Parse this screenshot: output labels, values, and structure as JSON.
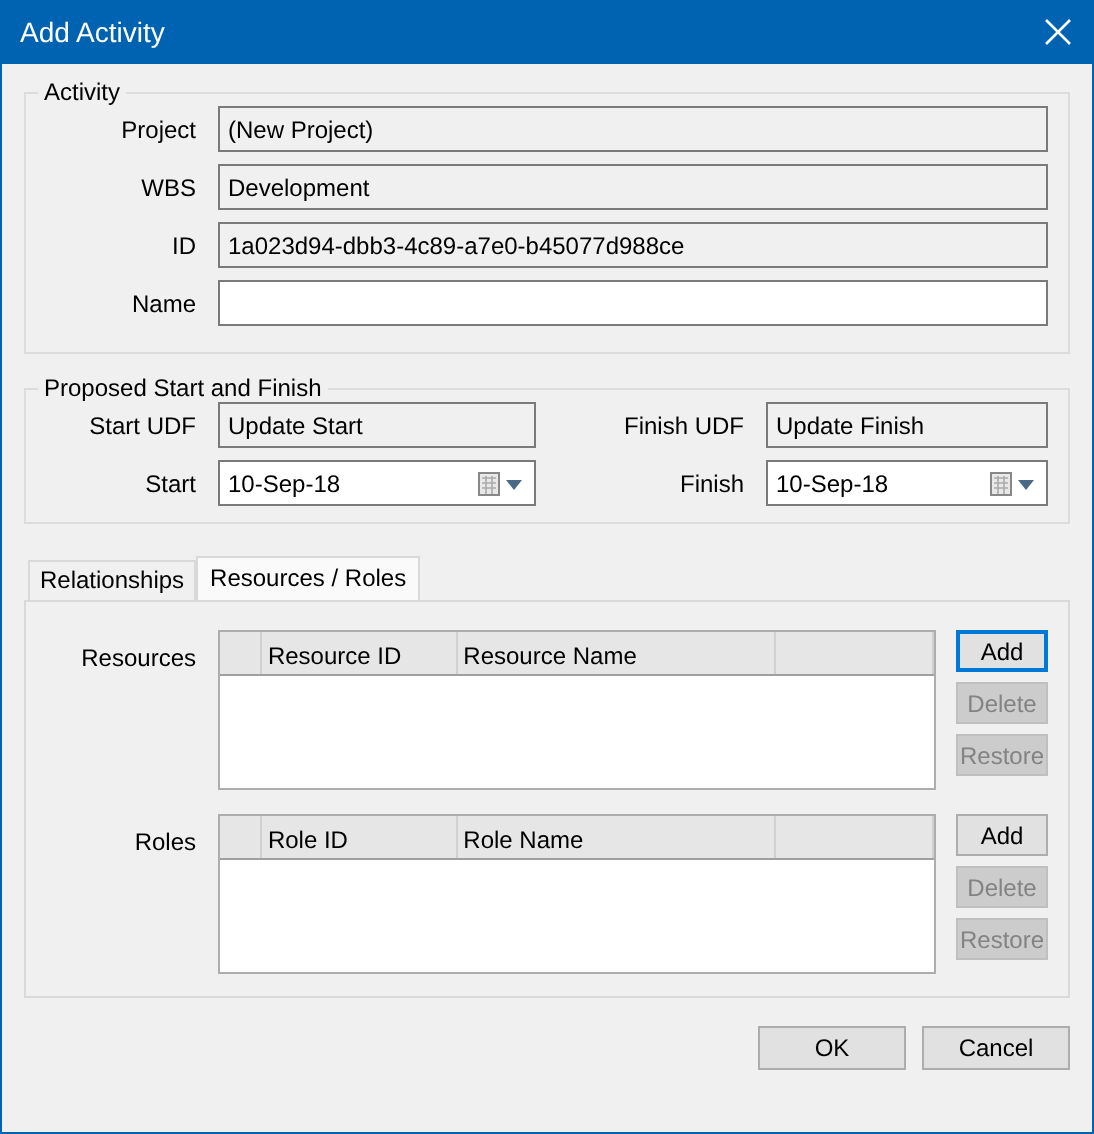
{
  "window": {
    "title": "Add Activity"
  },
  "activity": {
    "legend": "Activity",
    "fields": [
      {
        "label": "Project",
        "value": "(New Project)",
        "kind": "readonly"
      },
      {
        "label": "WBS",
        "value": "Development",
        "kind": "readonly"
      },
      {
        "label": "ID",
        "value": "1a023d94-dbb3-4c89-a7e0-b45077d988ce",
        "kind": "readonly"
      },
      {
        "label": "Name",
        "kind": "editable"
      }
    ]
  },
  "proposed": {
    "legend": "Proposed Start and Finish",
    "columns": [
      {
        "udf_label": "Start UDF",
        "udf_value": "Update Start",
        "date_label": "Start",
        "date_value": "10-Sep-18"
      },
      {
        "udf_label": "Finish UDF",
        "udf_value": "Update Finish",
        "date_label": "Finish",
        "date_value": "10-Sep-18"
      }
    ]
  },
  "tabs": [
    {
      "label": "Relationships",
      "selected": false
    },
    {
      "label": "Resources / Roles",
      "selected": true
    }
  ],
  "sections": [
    {
      "label": "Resources",
      "columns": [
        "Resource ID",
        "Resource Name"
      ],
      "buttons": [
        {
          "label": "Add",
          "disabled": false,
          "focused": true
        },
        {
          "label": "Delete",
          "disabled": true,
          "focused": false
        },
        {
          "label": "Restore",
          "disabled": true,
          "focused": false
        }
      ]
    },
    {
      "label": "Roles",
      "columns": [
        "Role ID",
        "Role Name"
      ],
      "buttons": [
        {
          "label": "Add",
          "disabled": false,
          "focused": false
        },
        {
          "label": "Delete",
          "disabled": true,
          "focused": false
        },
        {
          "label": "Restore",
          "disabled": true,
          "focused": false
        }
      ]
    }
  ],
  "footer_buttons": [
    {
      "label": "OK"
    },
    {
      "label": "Cancel"
    }
  ]
}
